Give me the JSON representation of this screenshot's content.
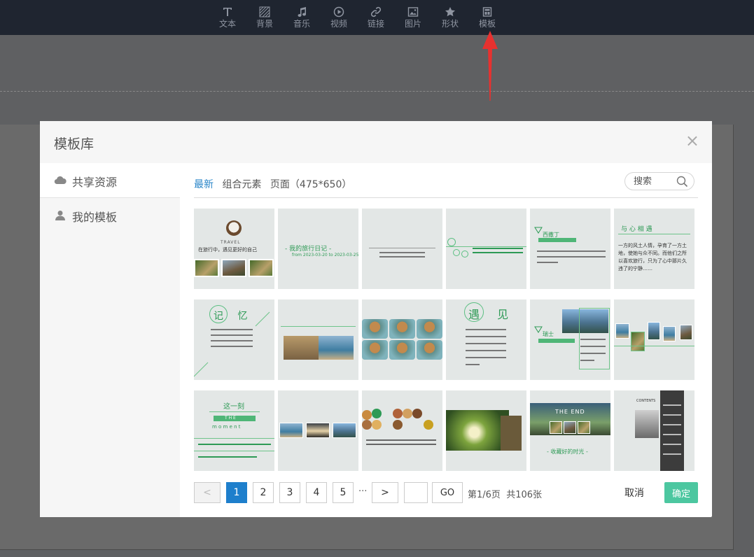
{
  "toolbar": {
    "items": [
      {
        "label": "文本",
        "icon": "text-icon"
      },
      {
        "label": "背景",
        "icon": "background-icon"
      },
      {
        "label": "音乐",
        "icon": "music-icon"
      },
      {
        "label": "视频",
        "icon": "video-icon"
      },
      {
        "label": "链接",
        "icon": "link-icon"
      },
      {
        "label": "图片",
        "icon": "image-icon"
      },
      {
        "label": "形状",
        "icon": "star-shape-icon"
      },
      {
        "label": "模板",
        "icon": "template-icon"
      }
    ]
  },
  "annotation": {
    "arrow_color": "#e8312f",
    "points_to": "模板"
  },
  "modal": {
    "title": "模板库",
    "close_label": "×",
    "sidebar": [
      {
        "label": "共享资源",
        "icon": "cloud-icon",
        "active": true
      },
      {
        "label": "我的模板",
        "icon": "user-icon",
        "active": false
      }
    ],
    "tabs": [
      {
        "label": "最新",
        "active": true
      },
      {
        "label": "组合元素",
        "active": false
      },
      {
        "label": "页面（475*650）",
        "active": false
      }
    ],
    "search": {
      "placeholder": "搜索",
      "icon": "search-icon"
    },
    "templates": {
      "t1": {
        "heading": "TRAVEL",
        "line": "在旅行中，遇见更好的自己"
      },
      "t2": {
        "heading": "- 我的旅行日记 -",
        "line": "from 2023-03-20 to 2023-03-25"
      },
      "t3": {},
      "t4": {},
      "t5": {
        "heading": "西撒丁"
      },
      "t6": {
        "heading": "与 心 相 遇",
        "body": "一方的风土人情，孕育了一方土地，使她与众不同。而他们之所以喜欢旅行，只为了心中那片久违了的宁静……"
      },
      "t7": {
        "heading": "记 忆"
      },
      "t8": {},
      "t9": {},
      "t10": {
        "heading": "遇 见"
      },
      "t11": {
        "heading": "瑞士"
      },
      "t12": {},
      "t13": {
        "heading": "这一刻",
        "sub1": "T H E",
        "sub2": "m o m e n t"
      },
      "t14": {},
      "t15": {},
      "t16": {},
      "t17": {
        "heading": "THE END",
        "line": "- 收藏好的时光 -"
      },
      "t18": {
        "heading": "CONTENTS"
      }
    },
    "pagination": {
      "prev_label": "<",
      "pages": [
        "1",
        "2",
        "3",
        "4",
        "5"
      ],
      "current": "1",
      "ellipsis": "···",
      "next_label": ">",
      "go_label": "GO",
      "page_info": "第1/6页",
      "total_info": "共106张"
    },
    "actions": {
      "cancel_label": "取消",
      "confirm_label": "确定"
    }
  },
  "colors": {
    "accent": "#1e7fcc",
    "confirm": "#4cc7a0",
    "template_green": "#2d9a55",
    "topbar": "#1f2530"
  }
}
